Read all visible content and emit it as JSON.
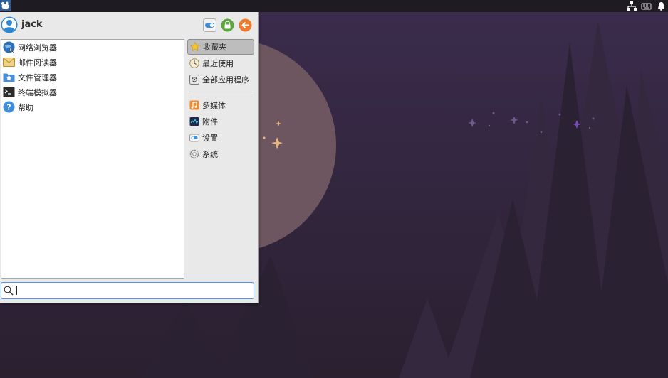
{
  "user": {
    "name": "jack"
  },
  "favorites": [
    {
      "label": "网络浏览器",
      "icon": "web-browser-icon"
    },
    {
      "label": "邮件阅读器",
      "icon": "mail-reader-icon"
    },
    {
      "label": "文件管理器",
      "icon": "file-manager-icon"
    },
    {
      "label": "终端模拟器",
      "icon": "terminal-icon"
    },
    {
      "label": "帮助",
      "icon": "help-icon"
    }
  ],
  "categories": [
    {
      "label": "收藏夹",
      "icon": "star-icon",
      "active": true
    },
    {
      "label": "最近使用",
      "icon": "clock-icon"
    },
    {
      "label": "全部应用程序",
      "icon": "all-apps-icon"
    },
    {
      "label": "多媒体",
      "icon": "multimedia-icon"
    },
    {
      "label": "附件",
      "icon": "accessories-icon"
    },
    {
      "label": "设置",
      "icon": "settings-icon"
    },
    {
      "label": "系统",
      "icon": "system-icon"
    }
  ],
  "search": {
    "value": ""
  },
  "colors": {
    "accent": "#5294e2",
    "panel": "#1f1b22",
    "wallpaper": "#2e2238"
  }
}
